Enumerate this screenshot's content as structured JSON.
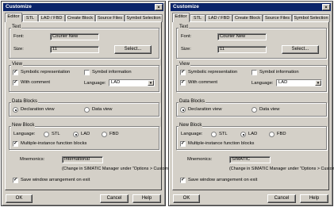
{
  "dialog_title": "Customize",
  "close_glyph": "×",
  "tabs": [
    "Editor",
    "STL",
    "LAD / FBD",
    "Create Block",
    "Source Files",
    "Symbol Selection"
  ],
  "text_group": {
    "label": "Text",
    "font_label": "Font:",
    "font_value": "Courier New",
    "size_label": "Size:",
    "size_value": "11",
    "select_button": "Select..."
  },
  "view_group": {
    "label": "View",
    "symbolic_representation": "Symbolic representation",
    "symbol_information": "Symbol information",
    "with_comment": "With comment",
    "language_label": "Language:",
    "language_value": "LAD"
  },
  "data_blocks_group": {
    "label": "Data Blocks",
    "declaration_view": "Declaration view",
    "data_view": "Data view"
  },
  "new_block_group": {
    "label": "New Block",
    "language_label": "Language:",
    "stl": "STL",
    "lad": "LAD",
    "fbd": "FBD",
    "multi_instance": "Multiple-instance function blocks"
  },
  "mnemonics_label": "Mnemonics:",
  "mnemonics_note": "(Change in SIMATIC Manager under \"Options > Customize\")",
  "save_window": "Save window arrangement on exit",
  "buttons": {
    "ok": "OK",
    "cancel": "Cancel",
    "help": "Help"
  },
  "check_glyph": "✓",
  "dialogs": [
    {
      "mnemonics_value": "International"
    },
    {
      "mnemonics_value": "SIMATIC"
    }
  ]
}
